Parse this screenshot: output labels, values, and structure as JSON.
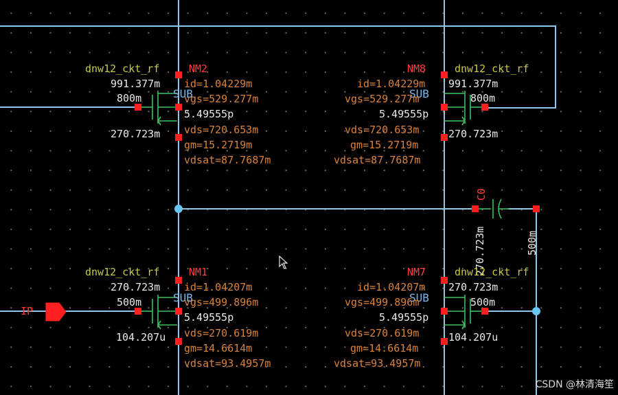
{
  "transistors": {
    "nm2": {
      "cell": "dnw12_ckt_rf",
      "name": "NM2",
      "sub": "SUB",
      "gate_side_top": "991.377m",
      "width": "800m",
      "gate_side_bottom": "270.723m",
      "id": "id=1.04229m",
      "vgs": "vgs=529.277m",
      "cap": "5.49555p",
      "vds": "vds=720.653m",
      "gm": "gm=15.2719m",
      "vdsat": "vdsat=87.7687m"
    },
    "nm8": {
      "cell": "dnw12_ckt_rf",
      "name": "NM8",
      "sub": "SUB",
      "gate_side_top": "991.377m",
      "width": "800m",
      "gate_side_bottom": "270.723m",
      "id": "id=1.04229m",
      "vgs": "vgs=529.277m",
      "cap": "5.49555p",
      "vds": "vds=720.653m",
      "gm": "gm=15.2719m",
      "vdsat": "vdsat=87.7687m"
    },
    "nm1": {
      "cell": "dnw12_ckt_rf",
      "name": "NM1",
      "sub": "SUB",
      "gate_side_top": "270.723m",
      "width": "500m",
      "gate_side_bottom": "104.207u",
      "id": "id=1.04207m",
      "vgs": "vgs=499.896m",
      "cap": "5.49555p",
      "vds": "vds=270.619m",
      "gm": "gm=14.6614m",
      "vdsat": "vdsat=93.4957m"
    },
    "nm7": {
      "cell": "dnw12_ckt_rf",
      "name": "NM7",
      "sub": "SUB",
      "gate_side_top": "270.723m",
      "width": "500m",
      "gate_side_bottom": "104.207u",
      "id": "id=1.04207m",
      "vgs": "vgs=499.896m",
      "cap": "5.49555p",
      "vds": "vds=270.619m",
      "gm": "gm=14.6614m",
      "vdsat": "vdsat=93.4957m"
    }
  },
  "capacitor": {
    "name": "C0",
    "left_voltage": "270.723m",
    "right_voltage": "500m"
  },
  "input_pin": {
    "label": "IP"
  },
  "watermark": "CSDN @林清海笙",
  "colors": {
    "background": "#000000",
    "wire": "#8fc6ec",
    "pin": "#ff1f1f",
    "net_voltage": "#e8e8e8",
    "op_param": "#d8823a",
    "cell_name": "#c8c840",
    "instance_name": "#ff3c3c",
    "device_symbol": "#3fbf5f"
  },
  "icons": [
    "mouse-pointer-icon",
    "input-pin-icon",
    "capacitor-icon",
    "nmos-icon"
  ]
}
